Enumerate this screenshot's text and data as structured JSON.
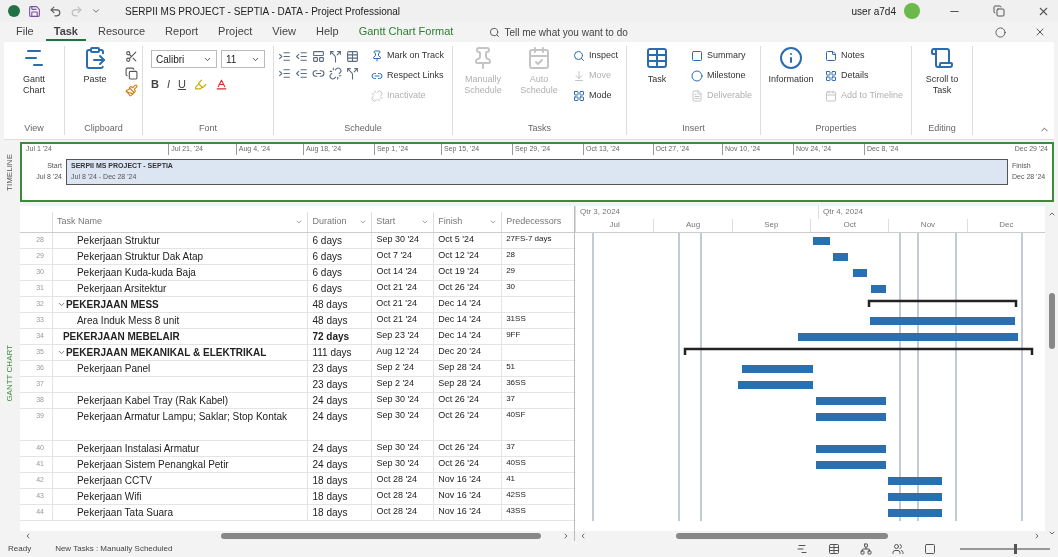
{
  "window": {
    "title": "SERPII MS PROJECT - SEPTIA - DATA - Project Professional",
    "user": "user a7d4"
  },
  "menu": [
    {
      "label": "File",
      "selected": false,
      "kind": "plain"
    },
    {
      "label": "Task",
      "selected": true,
      "kind": "plain"
    },
    {
      "label": "Resource",
      "selected": false,
      "kind": "plain"
    },
    {
      "label": "Report",
      "selected": false,
      "kind": "plain"
    },
    {
      "label": "Project",
      "selected": false,
      "kind": "plain"
    },
    {
      "label": "View",
      "selected": false,
      "kind": "plain"
    },
    {
      "label": "Help",
      "selected": false,
      "kind": "plain"
    },
    {
      "label": "Gantt Chart Format",
      "selected": false,
      "kind": "context"
    }
  ],
  "tell_me": {
    "placeholder": "Tell me what you want to do"
  },
  "ribbon": [
    {
      "label": "View",
      "items": [
        {
          "label": "Gantt Chart",
          "kind": "large",
          "disabled": false
        }
      ]
    },
    {
      "label": "Clipboard",
      "items": [
        {
          "label": "Paste",
          "kind": "large",
          "disabled": false
        }
      ]
    },
    {
      "label": "Font",
      "font": "Calibri",
      "size": "11",
      "styles": [
        "B",
        "I",
        "U"
      ]
    },
    {
      "label": "Schedule",
      "items": [
        {
          "label": "Mark on Track",
          "kind": "small",
          "disabled": false
        },
        {
          "label": "Respect Links",
          "kind": "small",
          "disabled": false
        },
        {
          "label": "Inactivate",
          "kind": "small",
          "disabled": true
        }
      ]
    },
    {
      "label": "Tasks",
      "items": [
        {
          "label": "Manually Schedule",
          "kind": "large",
          "disabled": true
        },
        {
          "label": "Auto Schedule",
          "kind": "large",
          "disabled": true
        },
        {
          "label": "Inspect",
          "kind": "small",
          "disabled": false
        },
        {
          "label": "Move",
          "kind": "small",
          "disabled": true
        },
        {
          "label": "Mode",
          "kind": "small",
          "disabled": false
        }
      ]
    },
    {
      "label": "Insert",
      "items": [
        {
          "label": "Task",
          "kind": "large",
          "disabled": false
        },
        {
          "label": "Summary",
          "kind": "small",
          "disabled": false
        },
        {
          "label": "Milestone",
          "kind": "small",
          "disabled": false
        },
        {
          "label": "Deliverable",
          "kind": "small",
          "disabled": true
        }
      ]
    },
    {
      "label": "Properties",
      "items": [
        {
          "label": "Information",
          "kind": "large",
          "disabled": false
        },
        {
          "label": "Notes",
          "kind": "small",
          "disabled": false
        },
        {
          "label": "Details",
          "kind": "small",
          "disabled": false
        },
        {
          "label": "Add to Timeline",
          "kind": "small",
          "disabled": true
        }
      ]
    },
    {
      "label": "Editing",
      "items": [
        {
          "label": "Scroll to Task",
          "kind": "large",
          "disabled": false
        }
      ]
    }
  ],
  "timeline": {
    "side_label": "TIMELINE",
    "origin": "Jul 1 '24",
    "end": "Dec 29 '24",
    "start_label": "Start",
    "start_date": "Jul 8 '24",
    "finish_label": "Finish",
    "finish_date": "Dec 28 '24",
    "bar_title": "SERPII MS PROJECT - SEPTIA",
    "bar_dates": "Jul 8 '24 - Dec 28 '24",
    "ticks": [
      "Jul 21, '24",
      "Aug 4, '24",
      "Aug 18, '24",
      "Sep 1, '24",
      "Sep 15, '24",
      "Sep 29, '24",
      "Oct 13, '24",
      "Oct 27, '24",
      "Nov 10, '24",
      "Nov 24, '24",
      "Dec 8, '24"
    ]
  },
  "view_label": "GANTT CHART",
  "columns": [
    "Task Name",
    "Duration",
    "Start",
    "Finish",
    "Predecessors"
  ],
  "timescale": {
    "quarters": [
      "Qtr 3, 2024",
      "Qtr 4, 2024"
    ],
    "months": [
      "Jul",
      "Aug",
      "Sep",
      "Oct",
      "Nov",
      "Dec"
    ]
  },
  "rows": [
    {
      "children": [
        {
          "id": "28",
          "name": "Pekerjaan Struktur",
          "duration": "6 days",
          "start": "Sep 30 '24",
          "finish": "Oct 5 '24",
          "predecessors": "27FS-7 days",
          "bold": false
        },
        {
          "id": "29",
          "name": "Pekerjaan Struktur Dak Atap",
          "duration": "6 days",
          "start": "Oct 7 '24",
          "finish": "Oct 12 '24",
          "predecessors": "28",
          "bold": false
        },
        {
          "id": "30",
          "name": "Pekerjaan Kuda-kuda Baja",
          "duration": "6 days",
          "start": "Oct 14 '24",
          "finish": "Oct 19 '24",
          "predecessors": "29",
          "bold": false
        },
        {
          "id": "31",
          "name": "Pekerjaan Arsitektur",
          "duration": "6 days",
          "start": "Oct 21 '24",
          "finish": "Oct 26 '24",
          "predecessors": "30",
          "bold": false
        }
      ]
    },
    {
      "id": "32",
      "name": "PEKERJAAN MESS",
      "duration": "48 days",
      "start": "Oct 21 '24",
      "finish": "Dec 14 '24",
      "bold": true,
      "expanded": true,
      "children": [
        {
          "id": "33",
          "name": "Area Induk Mess 8 unit",
          "duration": "48 days",
          "start": "Oct 21 '24",
          "finish": "Dec 14 '24",
          "predecessors": "31SS",
          "bold": false
        }
      ]
    },
    {
      "id": "34",
      "name": "PEKERJAAN MEBELAIR",
      "duration": "72 days",
      "start": "Sep 23 '24",
      "finish": "Dec 14 '24",
      "predecessors": "9FF",
      "bold": true
    },
    {
      "id": "35",
      "name": "PEKERJAAN MEKANIKAL & ELEKTRIKAL",
      "duration": "111 days",
      "start": "Aug 12 '24",
      "finish": "Dec 20 '24",
      "bold": true,
      "expanded": true,
      "children": [
        {
          "id": "36",
          "name": "Pekerjaan Panel",
          "duration": "23 days",
          "start": "Sep 2 '24",
          "finish": "Sep 28 '24",
          "predecessors": "51",
          "bold": false
        },
        {
          "id": "37",
          "duration": "23 days",
          "start": "Sep 2 '24",
          "finish": "Sep 28 '24",
          "predecessors": "36SS",
          "bold": false
        },
        {
          "id": "38",
          "name": "Pekerjaan Kabel Tray (Rak Kabel)",
          "duration": "24 days",
          "start": "Sep 30 '24",
          "finish": "Oct 26 '24",
          "predecessors": "37",
          "bold": false
        },
        {
          "id": "39",
          "name": "Pekerjaan Armatur Lampu; Saklar; Stop Kontak",
          "duration": "24 days",
          "start": "Sep 30 '24",
          "finish": "Oct 26 '24",
          "predecessors": "40SF",
          "bold": false
        },
        {
          "id": "40",
          "name": "Pekerjaan Instalasi Armatur",
          "duration": "24 days",
          "start": "Sep 30 '24",
          "finish": "Oct 26 '24",
          "predecessors": "37",
          "bold": false
        },
        {
          "id": "41",
          "name": "Pekerjaan Sistem Penangkal Petir",
          "duration": "24 days",
          "start": "Sep 30 '24",
          "finish": "Oct 26 '24",
          "predecessors": "40SS",
          "bold": false
        },
        {
          "id": "42",
          "name": "Pekerjaan CCTV",
          "duration": "18 days",
          "start": "Oct 28 '24",
          "finish": "Nov 16 '24",
          "predecessors": "41",
          "bold": false
        },
        {
          "id": "43",
          "name": "Pekerjaan Wifi",
          "duration": "18 days",
          "start": "Oct 28 '24",
          "finish": "Nov 16 '24",
          "predecessors": "42SS",
          "bold": false
        },
        {
          "id": "44",
          "name": "Pekerjaan Tata Suara",
          "duration": "18 days",
          "start": "Oct 28 '24",
          "finish": "Nov 16 '24",
          "predecessors": "43SS",
          "bold": false
        }
      ]
    }
  ],
  "status_bar": {
    "state": "Ready",
    "mode": "New Tasks : Manually Scheduled",
    "zoom": {
      "level": 0.6
    }
  }
}
